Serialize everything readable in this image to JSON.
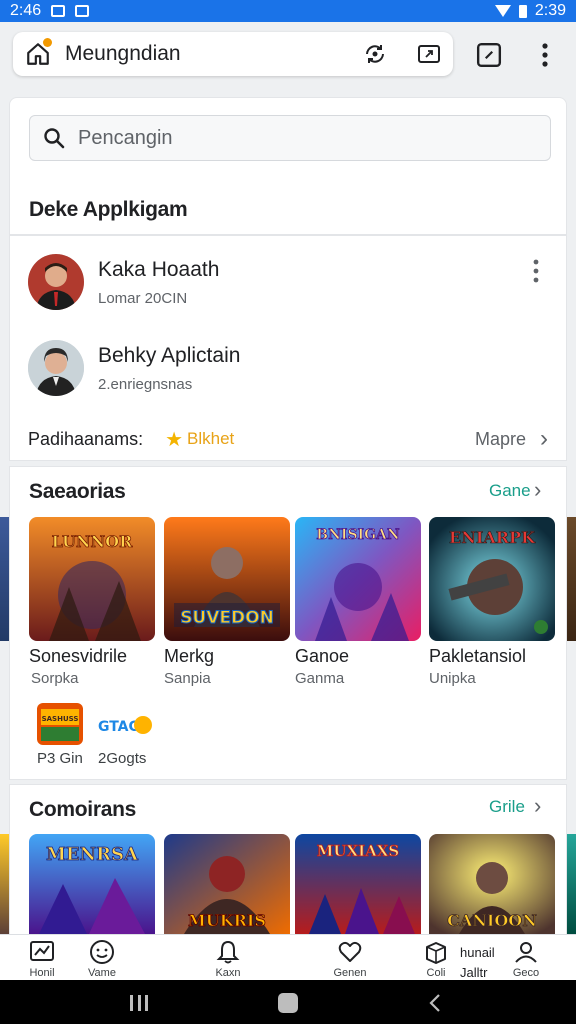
{
  "status_bar": {
    "time_left": "2:46",
    "time_right": "2:39"
  },
  "top_bar": {
    "title": "Meungndian"
  },
  "search": {
    "placeholder": "Pencangin"
  },
  "section1": {
    "title": "Deke Applkigam"
  },
  "users": [
    {
      "name": "Kaka Hoaath",
      "sub": "Lomar 20CIN"
    },
    {
      "name": "Behky Aplictain",
      "sub": "2.enriegnsnas"
    }
  ],
  "label_row": {
    "label": "Padihaanams:",
    "tag": "Blkhet",
    "more": "Mapre"
  },
  "section2": {
    "title": "Saeaorias",
    "link": "Gane",
    "tiles": [
      {
        "title": "Sonesvidrile",
        "sub": "Sorpka",
        "art": "LUNNOR"
      },
      {
        "title": "Merkg",
        "sub": "Sanpia",
        "art": "SUVEDON"
      },
      {
        "title": "Ganoe",
        "sub": "Ganma",
        "art": "BNISIGAN"
      },
      {
        "title": "Pakletansiol",
        "sub": "Unipka",
        "art": "ENIARPK"
      }
    ],
    "mini_apps": [
      {
        "sub": "P3 Gin",
        "art": "SASHUSS"
      },
      {
        "sub": "2Gogts",
        "art": "GTAG"
      }
    ]
  },
  "section3": {
    "title": "Comoirans",
    "link": "Grile",
    "tiles": [
      {
        "art": "MENRSA"
      },
      {
        "art": "MUKRIS"
      },
      {
        "art": "MUXIAXS"
      },
      {
        "art": "CANIOON"
      }
    ]
  },
  "bottom_nav": [
    {
      "label": "Honil"
    },
    {
      "label": "Vame"
    },
    {
      "label": "Kaxn"
    },
    {
      "label": "Genen"
    },
    {
      "label": "Coli"
    },
    {
      "label": "Geco"
    }
  ],
  "bottom_nav_extra": {
    "top": "hunail",
    "bottom": "Jalltr"
  },
  "colors": {
    "status_bar": "#1a73e8",
    "accent_link": "#1a9e8a",
    "star": "#f4b400"
  }
}
